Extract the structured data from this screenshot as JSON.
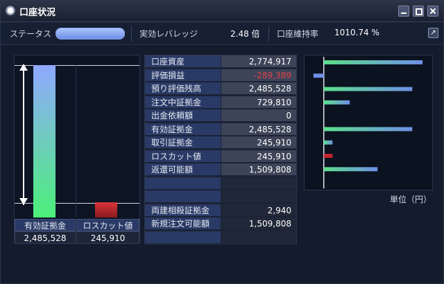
{
  "window": {
    "title": "口座状況"
  },
  "status_bar": {
    "status_label": "ステータス",
    "leverage_label": "実効レバレッジ",
    "leverage_value": "2.48 倍",
    "maintenance_label": "口座維持率",
    "maintenance_value": "1010.74 %"
  },
  "gauge": {
    "effective_margin_label": "有効証拠金",
    "effective_margin_value": "2,485,528",
    "losscut_label": "ロスカット値",
    "losscut_value": "245,910",
    "effective_margin_amount": 2485528,
    "losscut_amount": 245910
  },
  "table": {
    "rows": [
      {
        "label": "口座資産",
        "value": "2,774,917",
        "negative": false
      },
      {
        "label": "評価損益",
        "value": "-289,389",
        "negative": true
      },
      {
        "label": "預り評価残高",
        "value": "2,485,528",
        "negative": false
      },
      {
        "label": "注文中証拠金",
        "value": "729,810",
        "negative": false
      },
      {
        "label": "出金依頼額",
        "value": "0",
        "negative": false
      },
      {
        "label": "有効証拠金",
        "value": "2,485,528",
        "negative": false
      },
      {
        "label": "取引証拠金",
        "value": "245,910",
        "negative": false
      },
      {
        "label": "ロスカット値",
        "value": "245,910",
        "negative": false
      },
      {
        "label": "返還可能額",
        "value": "1,509,808",
        "negative": false
      },
      {
        "label": "",
        "value": "",
        "negative": false
      },
      {
        "label": "",
        "value": "",
        "negative": false
      },
      {
        "label": "両建相殺証拠金",
        "value": "2,940",
        "negative": false
      },
      {
        "label": "新規注文可能額",
        "value": "1,509,808",
        "negative": false
      },
      {
        "label": "",
        "value": "",
        "negative": false
      }
    ]
  },
  "chart_data": {
    "type": "bar",
    "values": [
      2774917,
      -289389,
      2485528,
      729810,
      0,
      2485528,
      245910,
      245910,
      1509808
    ],
    "colors": {
      "positive": "#5be08a",
      "negative": "#c0272d",
      "accent": "#6f8fe6"
    }
  },
  "chart_unit": "単位（円）",
  "colors": {
    "label_bg": "#2a3a66",
    "value_bg": "#3d4458",
    "negative_text": "#e3414d",
    "status_pill": "#8aa6f0"
  }
}
